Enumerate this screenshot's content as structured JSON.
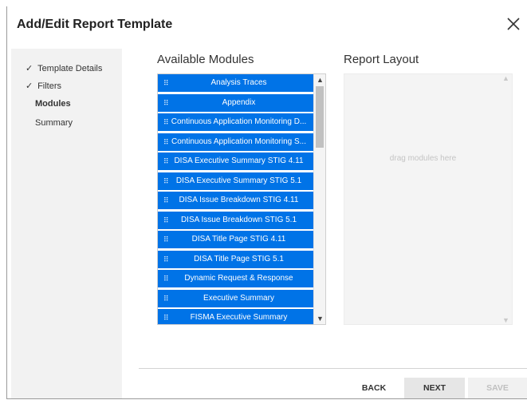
{
  "dialog": {
    "title": "Add/Edit Report Template",
    "close_glyph": "✕"
  },
  "steps": [
    {
      "label": "Template Details",
      "completed": true,
      "check": "✓",
      "active": false
    },
    {
      "label": "Filters",
      "completed": true,
      "check": "✓",
      "active": false
    },
    {
      "label": "Modules",
      "completed": false,
      "check": "",
      "active": true
    },
    {
      "label": "Summary",
      "completed": false,
      "check": "",
      "active": false
    }
  ],
  "available": {
    "title": "Available Modules",
    "grip_glyph": "⠿",
    "items": [
      "Analysis Traces",
      "Appendix",
      "Continuous Application Monitoring D...",
      "Continuous Application Monitoring S...",
      "DISA Executive Summary STIG 4.11",
      "DISA Executive Summary STIG 5.1",
      "DISA Issue Breakdown STIG 4.11",
      "DISA Issue Breakdown STIG 5.1",
      "DISA Title Page STIG 4.11",
      "DISA Title Page STIG 5.1",
      "Dynamic Request & Response",
      "Executive Summary",
      "FISMA Executive Summary",
      ""
    ],
    "scroll_up": "▲",
    "scroll_down": "▼"
  },
  "layout": {
    "title": "Report Layout",
    "placeholder": "drag modules here",
    "scroll_up": "▲",
    "scroll_down": "▼"
  },
  "buttons": {
    "back": "BACK",
    "next": "NEXT",
    "save": "SAVE"
  },
  "colors": {
    "module_bg": "#0073e7",
    "module_text": "#ffffff",
    "sidebar_bg": "#f2f2f2",
    "save_disabled_text": "#c0c0c0"
  },
  "icons": {
    "close": "close-icon",
    "check": "check-icon",
    "grip": "drag-handle-icon",
    "scroll_up": "scroll-up-arrow-icon",
    "scroll_down": "scroll-down-arrow-icon"
  }
}
